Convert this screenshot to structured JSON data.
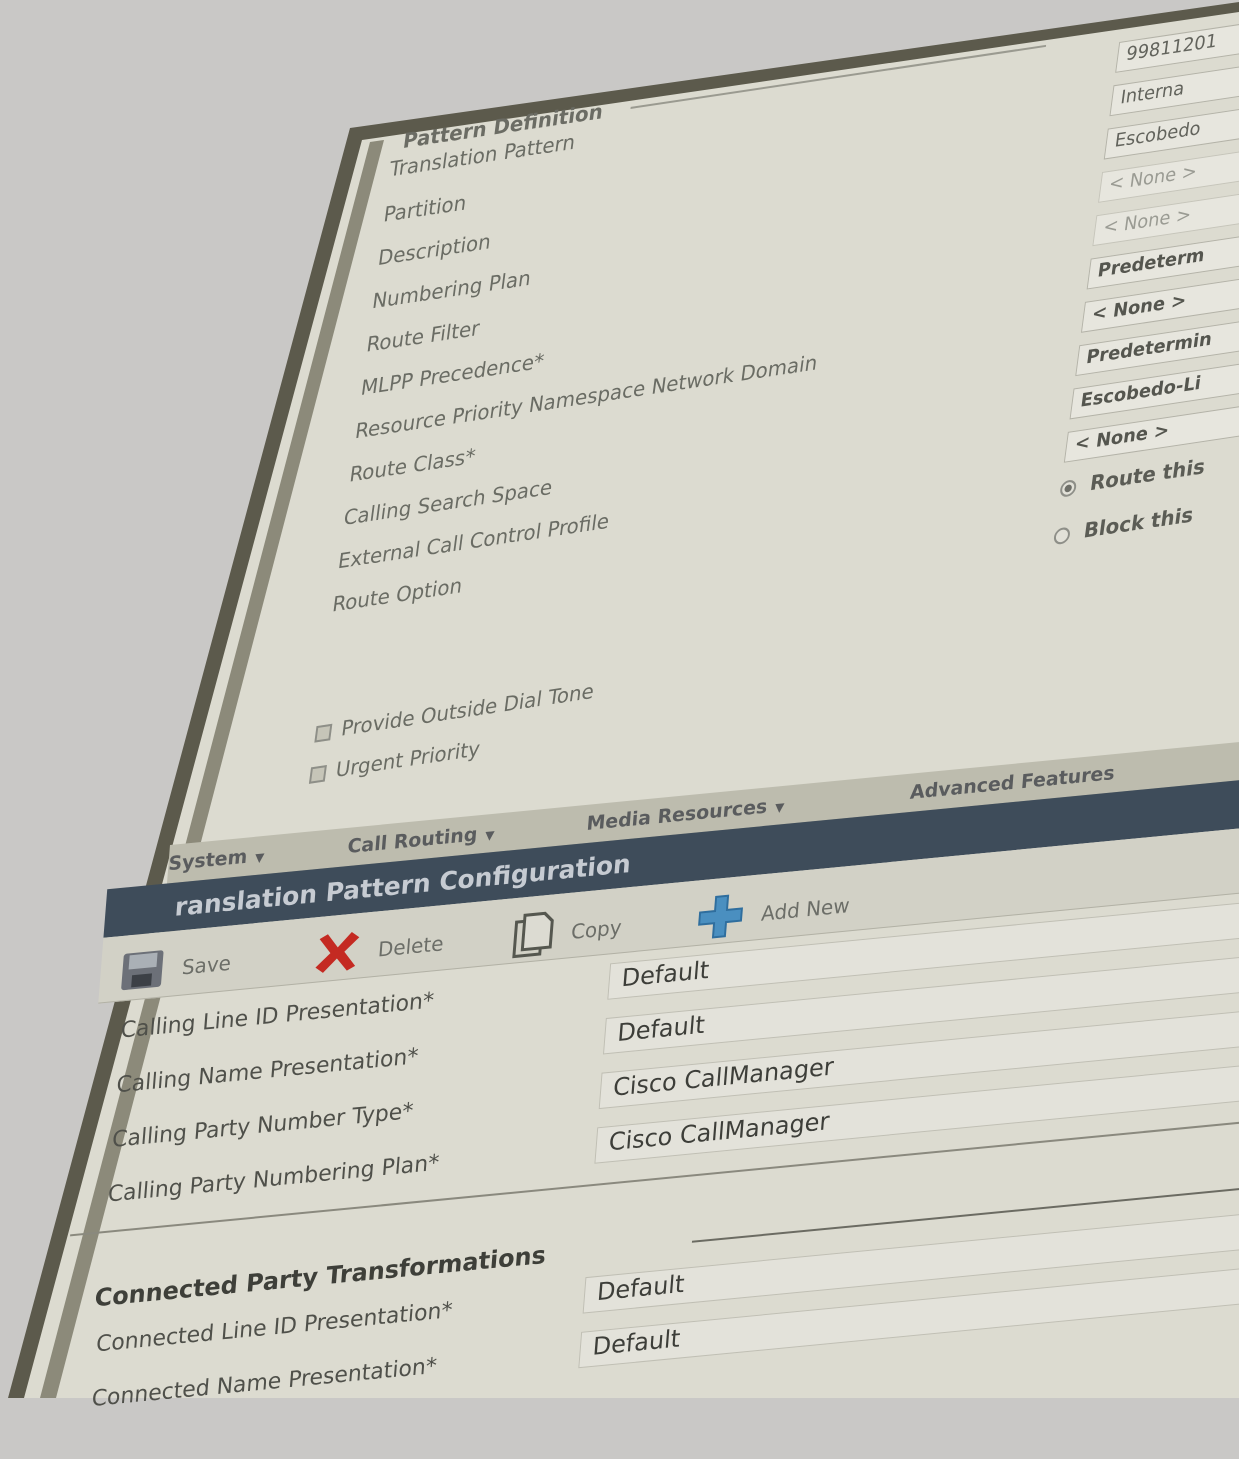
{
  "pattern_definition": {
    "legend": "Pattern Definition",
    "rows": [
      {
        "label": "Translation Pattern",
        "value": "99811201",
        "style": "plain"
      },
      {
        "label": "Partition",
        "value": "Interna",
        "style": "plain"
      },
      {
        "label": "Description",
        "value": "Escobedo",
        "style": "plain"
      },
      {
        "label": "Numbering Plan",
        "value": "< None >",
        "style": "faint"
      },
      {
        "label": "Route Filter",
        "value": "< None >",
        "style": "faint"
      },
      {
        "label": "MLPP Precedence*",
        "value": "Predeterm",
        "style": "bold"
      },
      {
        "label": "Resource Priority Namespace Network Domain",
        "value": "< None >",
        "style": "bold"
      },
      {
        "label": "Route Class*",
        "value": "Predetermin",
        "style": "bold"
      },
      {
        "label": "Calling Search Space",
        "value": "Escobedo-Li",
        "style": "bold"
      },
      {
        "label": "External Call Control Profile",
        "value": "< None >",
        "style": "bold"
      }
    ],
    "route_option_label": "Route Option",
    "route_options": [
      {
        "label": "Route this",
        "selected": true
      },
      {
        "label": "Block this",
        "selected": false
      }
    ],
    "checkboxes": [
      {
        "label": "Provide Outside Dial Tone",
        "checked": true
      },
      {
        "label": "Urgent Priority",
        "checked": true
      }
    ]
  },
  "menu": {
    "items": [
      "System",
      "Call Routing",
      "Media Resources",
      "Advanced Features"
    ]
  },
  "page_title": "ranslation Pattern Configuration",
  "toolbar": {
    "save_label": "Save",
    "delete_label": "Delete",
    "copy_label": "Copy",
    "add_new_label": "Add New"
  },
  "calling_fields": [
    {
      "label": "Calling Line ID Presentation*",
      "value": "Default"
    },
    {
      "label": "Calling Name Presentation*",
      "value": "Default"
    },
    {
      "label": "Calling Party Number Type*",
      "value": "Cisco CallManager"
    },
    {
      "label": "Calling Party Numbering Plan*",
      "value": "Cisco CallManager"
    }
  ],
  "connected_section": {
    "legend": "Connected Party Transformations",
    "fields": [
      {
        "label": "Connected Line ID Presentation*",
        "value": "Default"
      },
      {
        "label": "Connected Name Presentation*",
        "value": "Default"
      }
    ]
  },
  "colors": {
    "title_bar": "#3e4c5a",
    "delete_icon": "#c42a22",
    "add_icon": "#4a8fc0"
  }
}
